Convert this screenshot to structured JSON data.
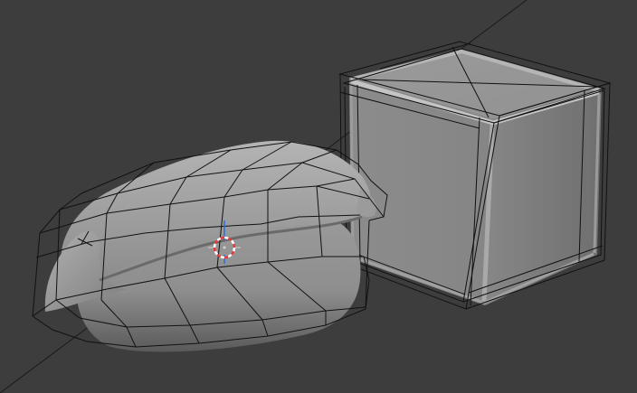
{
  "viewport": {
    "background": "#3d3d3d",
    "mode": "3d-viewport",
    "shading": "solid",
    "overlay": "subdivision-cage-wireframe"
  },
  "objects": [
    {
      "name": "sushi-mesh",
      "type": "mesh",
      "selected": false,
      "color": "#8f8f8f"
    },
    {
      "name": "cube-mesh",
      "type": "mesh",
      "selected": false,
      "color": "#8a8a8a"
    }
  ],
  "cursor": {
    "icon": "3d-cursor-icon",
    "ring_colors": [
      "#e63b3b",
      "#ffffff"
    ],
    "axis_color": "#2a6fd6"
  },
  "colors": {
    "wire": "#111111",
    "surface_light": "#a6a6a6",
    "surface_mid": "#8c8c8c",
    "surface_dark": "#5e5e5e",
    "bevel_highlight": "#c4c4c4"
  }
}
